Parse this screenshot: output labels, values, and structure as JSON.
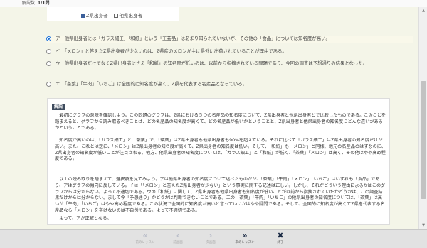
{
  "header": {
    "label": "解説数",
    "count": "1/1問"
  },
  "chart_legend": {
    "items": [
      {
        "label": "Z県出身者",
        "color": "#3b5f9a"
      },
      {
        "label": "他県出身者",
        "color": "#ffffff"
      }
    ]
  },
  "options": [
    {
      "text": "ア　他県出身者には「ガラス細工」「和紙」という「工芸品」はあまり知られていないが、その他の「食品」については知名度が高い。",
      "selected": true
    },
    {
      "text": "イ　「メロン」と答えたZ県出身者が少ないのは、Z県産のメロンが主に県外に出荷されていることが理由である。",
      "selected": false
    },
    {
      "text": "ウ　他県出身者だけでなくZ県出身者にさえ「和紙」の知名度が低いのは、以前から指摘されている問題であり、今回の調査は予想通りの結果となった。",
      "selected": false
    },
    {
      "text": "エ　「茶葉」「牛肉」「いちご」は全国的に知名度が高く、Z県を代表する名産品となっている。",
      "selected": false
    }
  ],
  "explanation": {
    "badge": "解説",
    "p1": "　最初にグラフの意味を確認しよう。この問題のグラフは、Z県における５つの名産品の知名度について、Z県出身者と他県出身者とで比較したものである。このことを踏まえると、グラフから読み取るべきことは、どの名産品の知名度が高くて、どの名産品が低いかということと、Z県出身者と他県出身者の知名度にどんな違いがあるかということである。",
    "p2": "　知名度が高いのは、「ガラス細工」と「茶葉」で、「茶葉」はZ県出身者も他県出身者も90%を超えている。それに比べて「ガラス細工」はZ県出身者の知名度だけが高い。また、これとは逆に、「メロン」はZ県出身者の知名度が高くて、Z県出身者の知名度は低い。そして、「和紙」も「メロン」と同様、地元の名産品のはずなのに、Z県出身者の知名度が低いことが注目される。他方、他県出身者の知名度については、「ガラス細工」と「和紙」が低く、「茶葉」「メロン」は高く、その他はやや高め程度である。",
    "p3": "　以上の読み取りを踏まえて、選択肢を見てみよう。アは他県出身者の知名度について述べたものだが、「茶葉」「牛肉」「メロン」「いちご」はいずれも「食品」であり、アはグラフの傾向に反している。イは「「メロン」と答えたZ県出身者が少ない」という事実に関する記述は正しい。しかし、それがどういう理由によるかはこのグラフからは分からない。よって不適切である。ウの「和紙」に関して、Z県出身者も他県出身者も知名度が低いことが以前から指摘されていたかどうかは、この調査結果だけからは分からない。まして今「予想通り」かどうかは判断できないことである。エの「茶葉」「牛肉」「いちご」の他県出身者の知名度については、「茶葉」は高いが「牛肉」「いちご」はやや高め程度である。この状況で全国的に知名度が高いと言っていいかはやや疑問である。そして、全国的に知名度が高くてZ県を代表する名産品なら「メロン」を挙げないのは不自然である。よって不適切である。",
    "p4": "　よって、アが正解となる。"
  },
  "footer": {
    "buttons": [
      {
        "icon": "«",
        "label": "前のレッスン",
        "enabled": false
      },
      {
        "icon": "‹",
        "label": "前画面",
        "enabled": false
      },
      {
        "icon": "›",
        "label": "次画面",
        "enabled": false
      },
      {
        "icon": "»",
        "label": "次のレッスン",
        "enabled": true
      },
      {
        "icon": "✖",
        "label": "終了",
        "enabled": true
      }
    ]
  }
}
